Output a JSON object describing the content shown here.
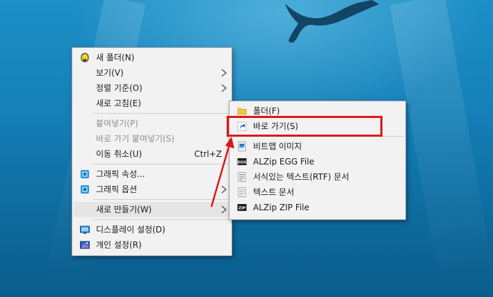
{
  "context_menu": {
    "items": [
      {
        "label": "새 폴더(N)",
        "icon": "lock-icon"
      },
      {
        "label": "보기(V)"
      },
      {
        "label": "정렬 기준(O)"
      },
      {
        "label": "새로 고침(E)"
      },
      {
        "label": "붙여넣기(P)"
      },
      {
        "label": "바로 가기 붙여넣기(S)"
      },
      {
        "label": "이동 취소(U)",
        "accel": "Ctrl+Z"
      },
      {
        "label": "그래픽 속성...",
        "icon": "graphics-properties-icon"
      },
      {
        "label": "그래픽 옵션",
        "icon": "graphics-options-icon"
      },
      {
        "label": "새로 만들기(W)"
      },
      {
        "label": "디스플레이 설정(D)",
        "icon": "display-settings-icon"
      },
      {
        "label": "개인 설정(R)",
        "icon": "personalize-icon"
      }
    ]
  },
  "submenu": {
    "items": [
      {
        "label": "폴더(F)",
        "icon": "folder-icon"
      },
      {
        "label": "바로 가기(S)",
        "icon": "shortcut-icon"
      },
      {
        "label": "비트맵 이미지",
        "icon": "bitmap-icon"
      },
      {
        "label": "ALZip EGG File",
        "icon": "egg-file-icon",
        "badge": "EGG"
      },
      {
        "label": "서식있는 텍스트(RTF) 문서",
        "icon": "rtf-document-icon"
      },
      {
        "label": "텍스트 문서",
        "icon": "text-document-icon"
      },
      {
        "label": "ALZip ZIP File",
        "icon": "zip-file-icon",
        "badge": "ZIP"
      }
    ]
  },
  "colors": {
    "highlight_box": "#e01515",
    "arrow": "#e01515",
    "menu_bg": "#f2f2f2"
  }
}
